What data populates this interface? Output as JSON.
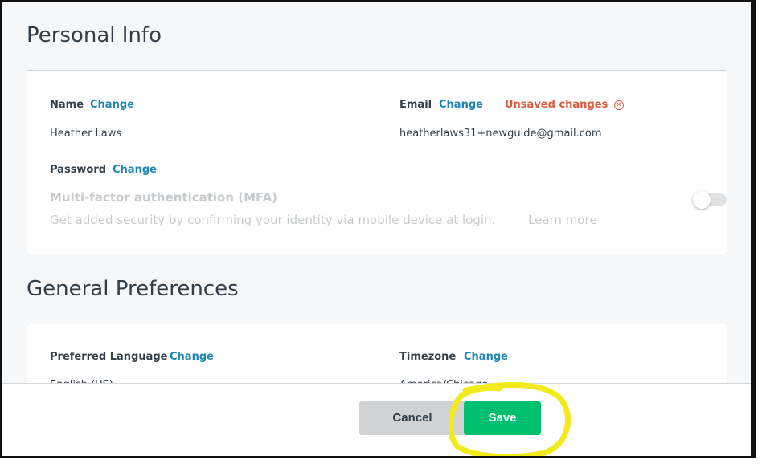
{
  "personal_info": {
    "title": "Personal Info",
    "name_label": "Name",
    "name_change": "Change",
    "name_value": "Heather Laws",
    "email_label": "Email",
    "email_change": "Change",
    "unsaved_text": "Unsaved changes",
    "email_value": "heatherlaws31+newguide@gmail.com",
    "password_label": "Password",
    "password_change": "Change",
    "mfa_title": "Multi-factor authentication (MFA)",
    "mfa_desc": "Get added security by confirming your identity via mobile device at login.",
    "mfa_learn_more": "Learn more",
    "mfa_enabled": false
  },
  "general_preferences": {
    "title": "General Preferences",
    "language_label": "Preferred Language",
    "language_change": "Change",
    "language_value": "English (US)",
    "timezone_label": "Timezone",
    "timezone_change": "Change",
    "timezone_value": "America/Chicago"
  },
  "footer": {
    "cancel_label": "Cancel",
    "save_label": "Save"
  },
  "colors": {
    "link": "#1e86b5",
    "unsaved": "#e05a3f",
    "save": "#00bf6f",
    "highlight": "#f2ea1a"
  }
}
